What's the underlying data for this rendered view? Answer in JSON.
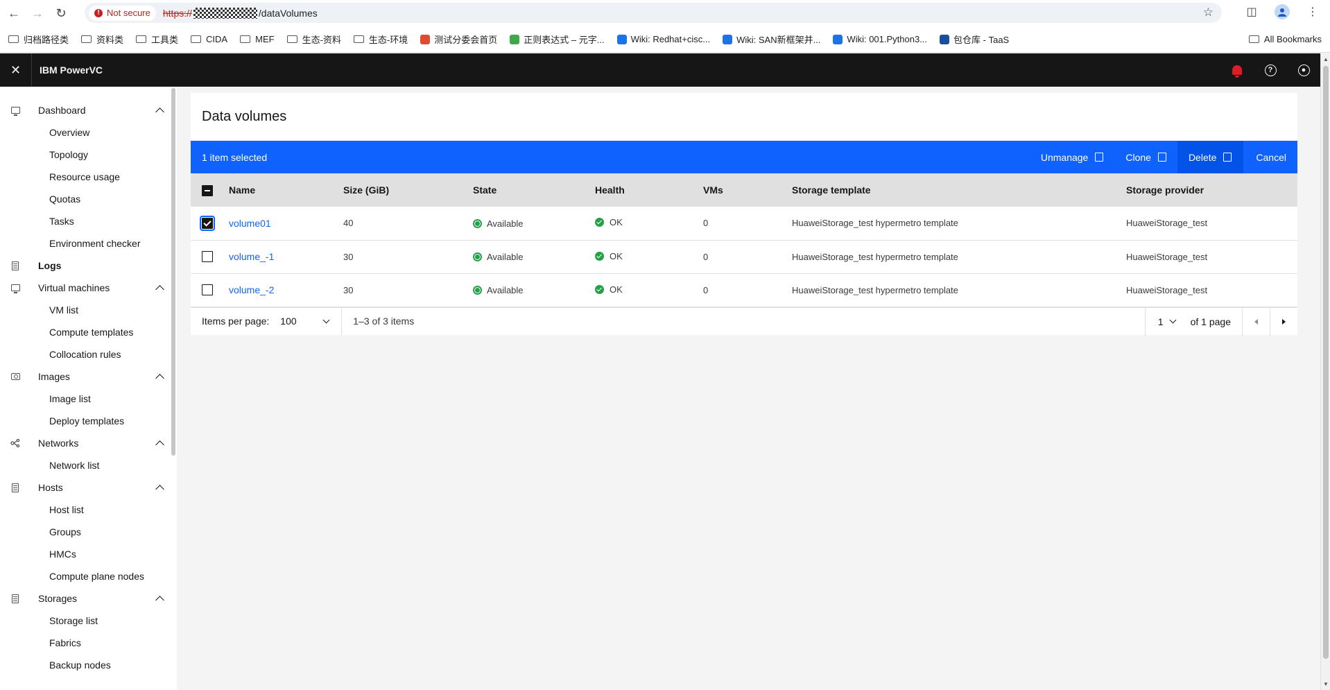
{
  "browser": {
    "security_label": "Not secure",
    "url_scheme": "https://",
    "url_path": "/dataVolumes",
    "bookmarks": [
      "归档路径类",
      "资料类",
      "工具类",
      "CIDA",
      "MEF",
      "生态-资料",
      "生态-环境",
      "测试分委会首页",
      "正则表达式 – 元字...",
      "Wiki: Redhat+cisc...",
      "Wiki: SAN新框架并...",
      "Wiki: 001.Python3...",
      "包仓库 - TaaS"
    ],
    "all_bookmarks": "All Bookmarks"
  },
  "app": {
    "title": "IBM PowerVC",
    "notification_color": "#da1e28"
  },
  "sidebar": {
    "dashboard": {
      "label": "Dashboard",
      "items": [
        "Overview",
        "Topology",
        "Resource usage",
        "Quotas",
        "Tasks",
        "Environment checker"
      ]
    },
    "logs": {
      "label": "Logs"
    },
    "virtual_machines": {
      "label": "Virtual machines",
      "items": [
        "VM list",
        "Compute templates",
        "Collocation rules"
      ]
    },
    "images": {
      "label": "Images",
      "items": [
        "Image list",
        "Deploy templates"
      ]
    },
    "networks": {
      "label": "Networks",
      "items": [
        "Network list"
      ]
    },
    "hosts": {
      "label": "Hosts",
      "items": [
        "Host list",
        "Groups",
        "HMCs",
        "Compute plane nodes"
      ]
    },
    "storages": {
      "label": "Storages",
      "items": [
        "Storage list",
        "Fabrics",
        "Backup nodes"
      ]
    }
  },
  "page": {
    "title": "Data volumes",
    "batch": {
      "selected_text": "1 item selected",
      "unmanage": "Unmanage",
      "clone": "Clone",
      "delete": "Delete",
      "cancel": "Cancel",
      "accent_color": "#0f62fe"
    },
    "table": {
      "headers": [
        "Name",
        "Size (GiB)",
        "State",
        "Health",
        "VMs",
        "Storage template",
        "Storage provider"
      ],
      "rows": [
        {
          "checked": true,
          "name": "volume01",
          "size": "40",
          "state": "Available",
          "health": "OK",
          "vms": "0",
          "template": "HuaweiStorage_test hypermetro template",
          "provider": "HuaweiStorage_test"
        },
        {
          "checked": false,
          "name": "volume_-1",
          "size": "30",
          "state": "Available",
          "health": "OK",
          "vms": "0",
          "template": "HuaweiStorage_test hypermetro template",
          "provider": "HuaweiStorage_test"
        },
        {
          "checked": false,
          "name": "volume_-2",
          "size": "30",
          "state": "Available",
          "health": "OK",
          "vms": "0",
          "template": "HuaweiStorage_test hypermetro template",
          "provider": "HuaweiStorage_test"
        }
      ]
    },
    "pagination": {
      "items_per_page_label": "Items per page:",
      "items_per_page_value": "100",
      "range_text": "1–3 of 3 items",
      "page_value": "1",
      "of_pages_text": "of 1 page"
    }
  }
}
